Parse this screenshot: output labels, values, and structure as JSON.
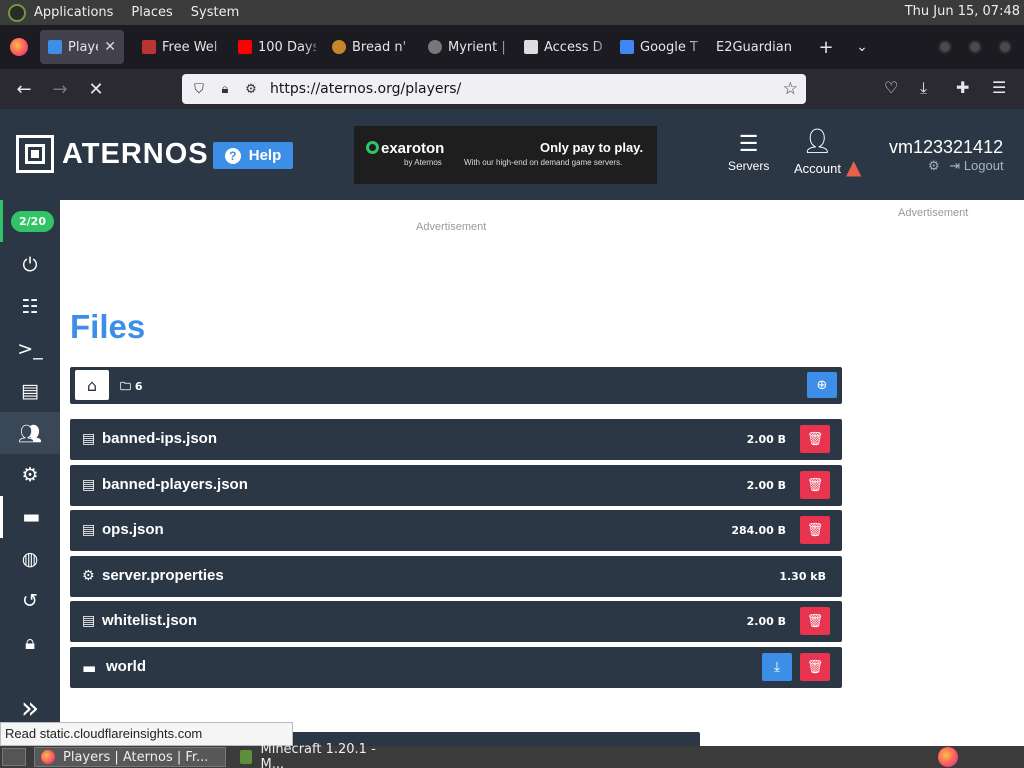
{
  "gnome_panel": {
    "menus": [
      "Applications",
      "Places",
      "System"
    ],
    "clock": "Thu Jun 15, 07:48"
  },
  "browser": {
    "tabs": [
      {
        "label": "Players",
        "icon": "aternos-favicon",
        "active": true
      },
      {
        "label": "Free Wel",
        "icon": "free-web-favicon"
      },
      {
        "label": "100 Days",
        "icon": "youtube-icon"
      },
      {
        "label": "Bread n'",
        "icon": "bread-favicon"
      },
      {
        "label": "Myrient |",
        "icon": "myrient-favicon"
      },
      {
        "label": "Access D",
        "icon": "access-favicon"
      },
      {
        "label": "Google T",
        "icon": "google-translate-icon"
      },
      {
        "label": "E2Guardian",
        "icon": ""
      }
    ],
    "url": "https://aternos.org/players/"
  },
  "header": {
    "brand": "ATERNOS",
    "help_label": "Help",
    "ad": {
      "logo": "exaroton",
      "logo_sub": "by Aternos",
      "headline": "Only pay to play.",
      "tagline": "With our high-end on demand game servers."
    },
    "servers_label": "Servers",
    "account_label": "Account",
    "username": "vm123321412",
    "logout_label": "Logout"
  },
  "sidebar": {
    "counter": "2/20",
    "items": [
      "power-icon",
      "options-icon",
      "console-icon",
      "log-icon",
      "players-icon",
      "settings-icon",
      "files-icon",
      "worlds-icon",
      "backups-icon",
      "access-icon"
    ]
  },
  "main": {
    "ad_label": "Advertisement",
    "title": "Files",
    "folder_count": "6",
    "files": [
      {
        "name": "banned-ips.json",
        "size": "2.00 B",
        "type": "file",
        "deletable": true
      },
      {
        "name": "banned-players.json",
        "size": "2.00 B",
        "type": "file",
        "deletable": true
      },
      {
        "name": "ops.json",
        "size": "284.00 B",
        "type": "file",
        "deletable": true
      },
      {
        "name": "server.properties",
        "size": "1.30 kB",
        "type": "config",
        "deletable": false
      },
      {
        "name": "whitelist.json",
        "size": "2.00 B",
        "type": "file",
        "deletable": true
      },
      {
        "name": "world",
        "size": "",
        "type": "folder",
        "deletable": true
      }
    ]
  },
  "status_text": "Read static.cloudflareinsights.com",
  "taskbar": {
    "items": [
      {
        "label": "Players | Aternos | Fr...",
        "active": true
      },
      {
        "label": "Minecraft 1.20.1 - M...",
        "active": false
      }
    ]
  }
}
